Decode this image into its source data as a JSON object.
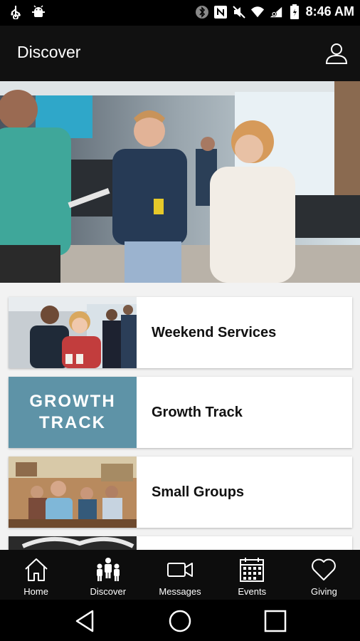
{
  "status_bar": {
    "time": "8:46 AM",
    "left_icons": [
      "usb-icon",
      "android-debug-icon"
    ],
    "right_icons": [
      "bluetooth-icon",
      "nfc-icon",
      "mute-icon",
      "wifi-icon",
      "cellular-icon",
      "battery-icon"
    ]
  },
  "app_bar": {
    "title": "Discover",
    "profile_icon": "person-icon"
  },
  "cards": [
    {
      "label": "Weekend Services"
    },
    {
      "label": "Growth Track",
      "thumb_text_line1": "GROWTH",
      "thumb_text_line2": "TRACK"
    },
    {
      "label": "Small Groups"
    },
    {
      "label": ""
    }
  ],
  "tab_bar": {
    "tabs": [
      {
        "label": "Home",
        "icon": "home-icon"
      },
      {
        "label": "Discover",
        "icon": "people-icon"
      },
      {
        "label": "Messages",
        "icon": "video-icon"
      },
      {
        "label": "Events",
        "icon": "calendar-icon"
      },
      {
        "label": "Giving",
        "icon": "heart-icon"
      }
    ]
  },
  "colors": {
    "appbar_bg": "#111111",
    "content_bg": "#f2f2f2",
    "growth_track_bg": "#5e93a7",
    "tab_bar_bg": "#0d0d0d"
  }
}
